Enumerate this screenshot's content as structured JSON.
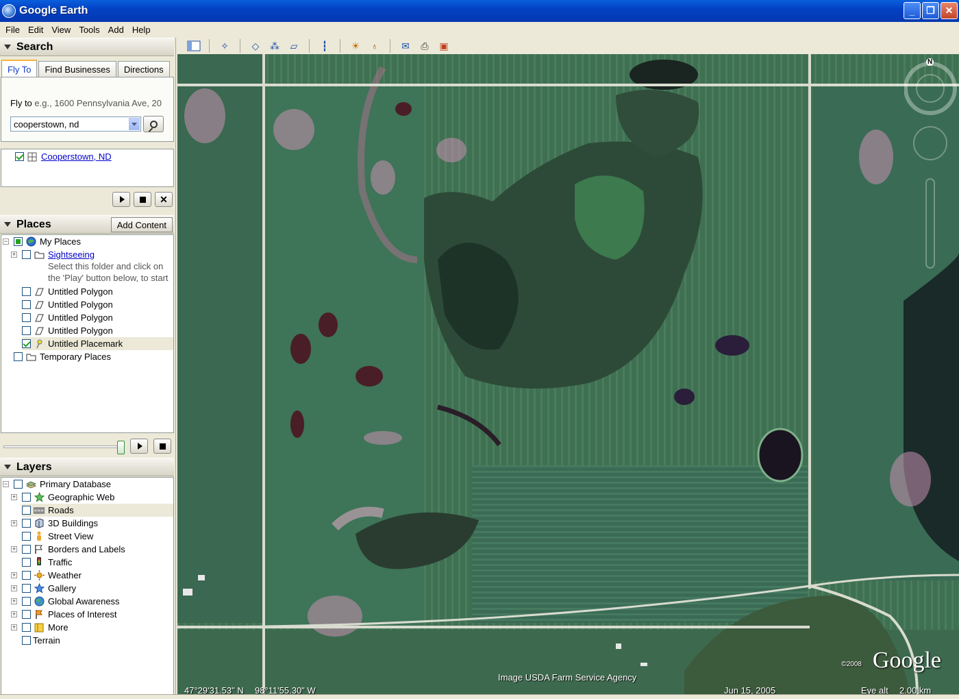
{
  "window": {
    "title": "Google Earth"
  },
  "menu": [
    "File",
    "Edit",
    "View",
    "Tools",
    "Add",
    "Help"
  ],
  "search": {
    "header": "Search",
    "tabs": [
      "Fly To",
      "Find Businesses",
      "Directions"
    ],
    "fly_to_label": "Fly to",
    "fly_to_hint": "e.g., 1600 Pennsylvania Ave, 20",
    "query": "cooperstown, nd",
    "result": "Cooperstown, ND"
  },
  "places": {
    "header": "Places",
    "add_content": "Add Content",
    "items": [
      {
        "label": "My Places"
      },
      {
        "label": "Sightseeing"
      },
      {
        "label": "Select this folder and click on"
      },
      {
        "label": "the 'Play' button below, to start"
      },
      {
        "label": "Untitled Polygon"
      },
      {
        "label": "Untitled Polygon"
      },
      {
        "label": "Untitled Polygon"
      },
      {
        "label": "Untitled Polygon"
      },
      {
        "label": "Untitled Placemark"
      },
      {
        "label": "Temporary Places"
      }
    ]
  },
  "layers": {
    "header": "Layers",
    "items": [
      {
        "label": "Primary Database"
      },
      {
        "label": "Geographic Web"
      },
      {
        "label": "Roads"
      },
      {
        "label": "3D Buildings"
      },
      {
        "label": "Street View"
      },
      {
        "label": "Borders and Labels"
      },
      {
        "label": "Traffic"
      },
      {
        "label": "Weather"
      },
      {
        "label": "Gallery"
      },
      {
        "label": "Global Awareness"
      },
      {
        "label": "Places of Interest"
      },
      {
        "label": "More"
      },
      {
        "label": "Terrain"
      }
    ]
  },
  "map": {
    "attribution": "Image USDA Farm Service Agency",
    "latitude": "47°29'31.53\" N",
    "longitude": "98°11'55.30\" W",
    "date": "Jun 15, 2005",
    "eye_alt_label": "Eye alt",
    "eye_alt": "2.00 km",
    "logo": "Google",
    "copyright": "©2008",
    "compass": "N"
  },
  "colors": {
    "titlebar": "#0342c4",
    "field_green": "#3d6e4e",
    "road": "#d9dcd0"
  }
}
